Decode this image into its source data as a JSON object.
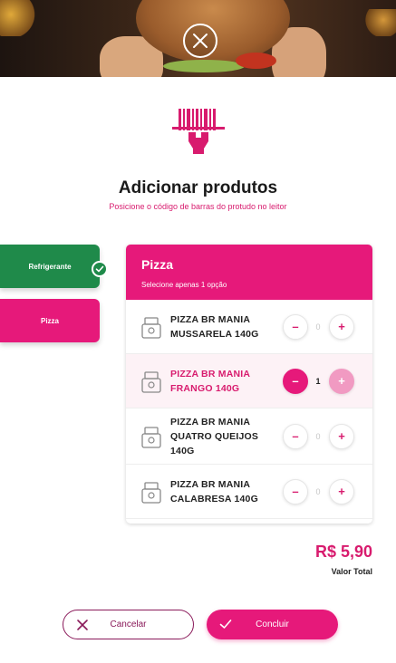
{
  "header": {
    "title": "Adicionar produtos",
    "subtitle": "Posicione o código de barras do protudo no leitor"
  },
  "categories": [
    {
      "label": "Refrigerante",
      "completed": true
    },
    {
      "label": "Pizza",
      "active": true
    }
  ],
  "panel": {
    "title": "Pizza",
    "subtitle": "Selecione apenas 1 opção"
  },
  "products": [
    {
      "name": "PIZZA BR MANIA MUSSARELA 140G",
      "qty": "0"
    },
    {
      "name": "PIZZA BR MANIA FRANGO 140G",
      "qty": "1"
    },
    {
      "name": "PIZZA BR MANIA QUATRO QUEIJOS 140G",
      "qty": "0"
    },
    {
      "name": "PIZZA BR MANIA CALABRESA 140G",
      "qty": "0"
    }
  ],
  "controls": {
    "minus": "–",
    "plus": "+"
  },
  "total": {
    "value": "R$ 5,90",
    "label": "Valor Total"
  },
  "actions": {
    "cancel": "Cancelar",
    "confirm": "Concluir"
  },
  "colors": {
    "primary": "#e6197a",
    "success": "#1f8a4a",
    "dark_accent": "#8a1a5a"
  },
  "icons": [
    "close-icon",
    "barcode-scanner-icon",
    "checkmark-icon",
    "product-box-icon",
    "x-icon",
    "check-icon"
  ]
}
